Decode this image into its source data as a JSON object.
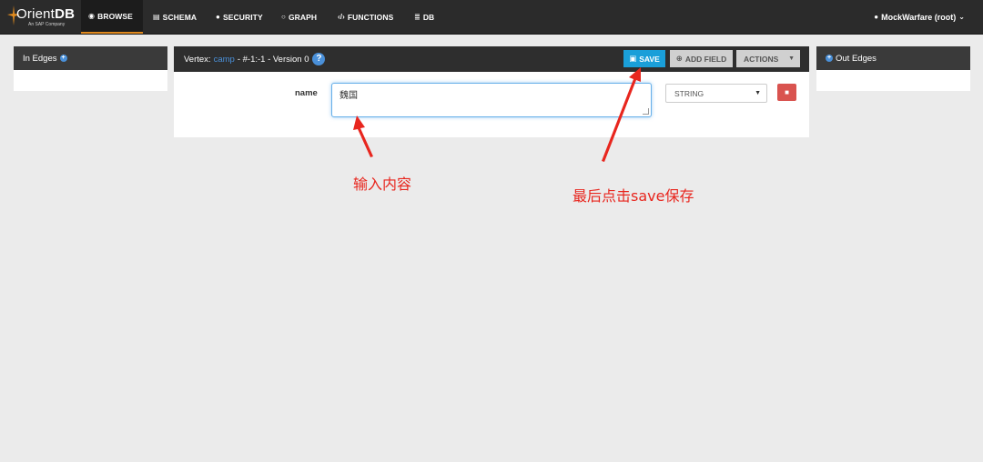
{
  "app": {
    "logo_text_light": "Orient",
    "logo_text_bold": "DB",
    "logo_subtitle": "An SAP Company",
    "accent": "#e08a1e"
  },
  "nav": [
    {
      "label": "BROWSE",
      "icon": "eye-icon",
      "active": true
    },
    {
      "label": "SCHEMA",
      "icon": "table-icon",
      "active": false
    },
    {
      "label": "SECURITY",
      "icon": "user-icon",
      "active": false
    },
    {
      "label": "GRAPH",
      "icon": "circle-icon",
      "active": false
    },
    {
      "label": "FUNCTIONS",
      "icon": "code-icon",
      "active": false
    },
    {
      "label": "DB",
      "icon": "database-icon",
      "active": false
    }
  ],
  "user": {
    "label": "MockWarfare (root)"
  },
  "in_edges": {
    "label": "In Edges"
  },
  "out_edges": {
    "label": "Out Edges"
  },
  "vertex": {
    "prefix": "Vertex:",
    "class_name": "camp",
    "suffix": "- #-1:-1 - Version 0",
    "help": "?"
  },
  "toolbar": {
    "save_label": "SAVE",
    "add_field_label": "ADD FIELD",
    "actions_label": "ACTIONS"
  },
  "field": {
    "name": "name",
    "value": "魏国",
    "type": "STRING"
  },
  "annotations": {
    "input_hint": "输入内容",
    "save_hint": "最后点击save保存",
    "color": "#e8261e"
  }
}
